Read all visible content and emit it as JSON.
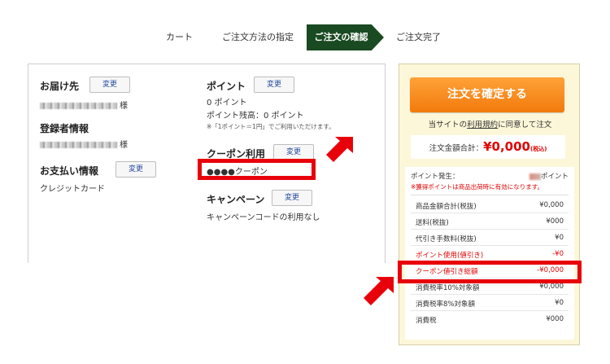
{
  "steps": {
    "cart": "カート",
    "method": "ご注文方法の指定",
    "confirm": "ご注文の確認",
    "done": "ご注文完了"
  },
  "delivery": {
    "title": "お届け先",
    "change": "変更",
    "name_suffix": "様"
  },
  "registrant": {
    "title": "登録者情報",
    "name_suffix": "様"
  },
  "payment": {
    "title": "お支払い情報",
    "change": "変更",
    "method": "クレジットカード"
  },
  "points": {
    "title": "ポイント",
    "change": "変更",
    "use": "0 ポイント",
    "balance": "ポイント残高：0 ポイント",
    "note": "※「1ポイント＝1円」でご利用いただけます。"
  },
  "coupon": {
    "title": "クーポン利用",
    "change": "変更",
    "value": "●●●●クーポン"
  },
  "campaign": {
    "title": "キャンペーン",
    "change": "変更",
    "value": "キャンペーンコードの利用なし"
  },
  "order": {
    "confirm_button": "注文を確定する",
    "agree_prefix": "当サイトの",
    "agree_link": "利用規約",
    "agree_suffix": "に同意して注文",
    "total_label": "注文金額合計：",
    "total_amount": "¥0,000",
    "tax_in": "(税込)",
    "points_earned_label": "ポイント発生：",
    "points_unit": "ポイント",
    "points_note": "※獲得ポイントは商品出荷時に有効になります。",
    "lines": [
      {
        "label": "商品金額合計(税抜)",
        "value": "¥0,000",
        "red": false
      },
      {
        "label": "送料(税抜)",
        "value": "¥000",
        "red": false
      },
      {
        "label": "代引き手数料(税抜)",
        "value": "¥0",
        "red": false
      },
      {
        "label": "ポイント使用(値引き)",
        "value": "-¥0",
        "red": true
      },
      {
        "label": "クーポン値引き総額",
        "value": "-¥0,000",
        "red": true
      },
      {
        "label": "消費税率10%対象額",
        "value": "¥0,000",
        "red": false
      },
      {
        "label": "消費税率8%対象額",
        "value": "¥0",
        "red": false
      },
      {
        "label": "消費税",
        "value": "¥000",
        "red": false
      }
    ]
  },
  "colors": {
    "step_active": "#1a4a22",
    "confirm_button": "#f27a0c",
    "highlight": "#e8000b",
    "panel_bg": "#fdf7d9"
  }
}
